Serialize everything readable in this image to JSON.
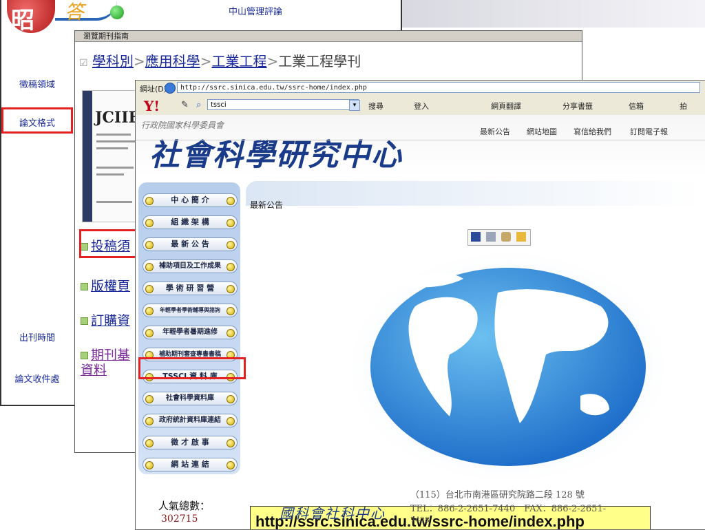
{
  "back_site": {
    "header_title": "中山管理評論",
    "logo_chars": "昭",
    "logo_swoosh_chars": "答",
    "sidebar": [
      {
        "label": "徵稿領域"
      },
      {
        "label": "論文格式"
      },
      {
        "label": "出刊時間"
      },
      {
        "label": "論文收件處"
      }
    ]
  },
  "browse_window": {
    "header": "瀏覽期刊指南",
    "breadcrumb": [
      "學科別",
      "應用科學",
      "工業工程",
      "工業工程學刊"
    ],
    "breadcrumb_sep": ">",
    "cover_title": "JCIIE",
    "items": [
      {
        "label": "投稿須"
      },
      {
        "label": "版權頁"
      },
      {
        "label": "訂購資"
      },
      {
        "label": "期刊基"
      }
    ],
    "item_extra": "資料"
  },
  "browser": {
    "address_label": "網址(D)",
    "address_url": "http://ssrc.sinica.edu.tw/ssrc-home/index.php",
    "toolbar": {
      "search_query": "tssci",
      "search_label": "搜尋",
      "login_label": "登入",
      "translate_label": "網頁翻譯",
      "bookmark_label": "分享書籤",
      "mail_label": "信箱",
      "extra_label": "拍"
    }
  },
  "ssrc": {
    "org_line": "行政院國家科學委員會",
    "name": "社會科學研究中心",
    "top_nav": [
      "最新公告",
      "網站地圖",
      "寫信給我們",
      "訂閱電子報"
    ],
    "left_nav": [
      {
        "label": "中 心 簡 介"
      },
      {
        "label": "組 織 架 構"
      },
      {
        "label": "最 新 公 告"
      },
      {
        "label": "補助項目及工作成果"
      },
      {
        "label": "學 術 研 習 營"
      },
      {
        "label": "年輕學者學術輔導與諮詢"
      },
      {
        "label": "年輕學者暑期進修"
      },
      {
        "label": "補助期刊審查專書書稿"
      },
      {
        "label": "TSSCI 資 料 庫"
      },
      {
        "label": "社會科學資料庫"
      },
      {
        "label": "政府統計資料庫連結"
      },
      {
        "label": "徵 才 啟 事"
      },
      {
        "label": "網 站 連 結"
      }
    ],
    "content_title": "最新公告",
    "callout_url": "http://ssrc.sinica.edu.tw/ssrc-home/index.php",
    "hits_label": "人氣總數：",
    "hits_value": "302715",
    "footer_logo": "國科會社科中心",
    "footer_address": "（115）台北市南港區研究院路二段 128 號",
    "footer_phone": "TEL：886-2-2651-7440　FAX：886-2-2651-",
    "footer_phone_tail": "7428"
  },
  "colors": {
    "highlight": "#e52020",
    "link": "#1a2a9a",
    "ssrc_blue": "#1a3a8a",
    "callout_bg": "#ffff8a"
  }
}
